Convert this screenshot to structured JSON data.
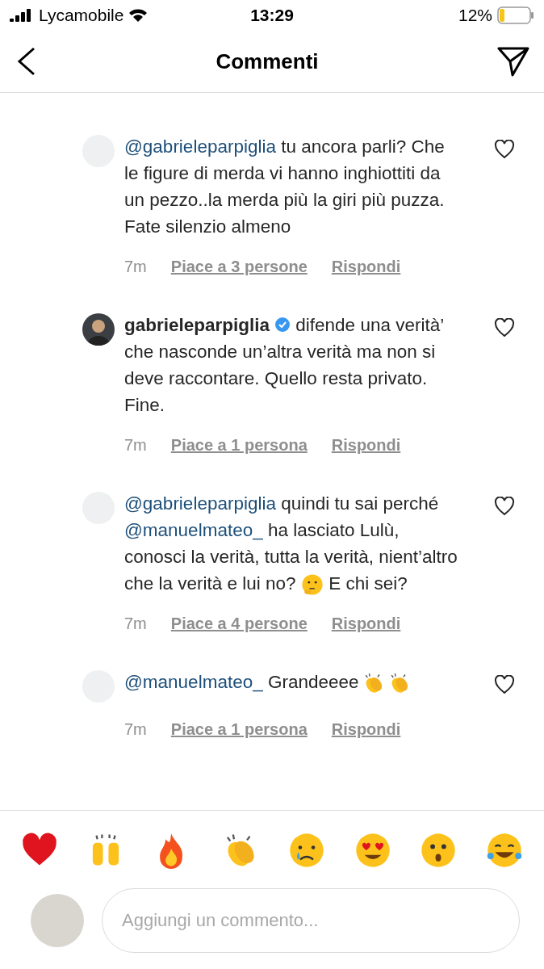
{
  "status_bar": {
    "carrier": "Lycamobile",
    "time": "13:29",
    "battery": "12%"
  },
  "header": {
    "title": "Commenti"
  },
  "comments": [
    {
      "avatar": {
        "kind": "blank"
      },
      "body": [
        {
          "kind": "mention",
          "text": "@gabrieleparpiglia"
        },
        {
          "kind": "text",
          "text": " tu ancora parli? Che le figure di merda vi hanno inghiottiti da un pezzo..la merda più la giri più puzza. Fate silenzio almeno"
        }
      ],
      "liked": false,
      "time": "7m",
      "likes": "Piace a 3 persone",
      "reply": "Rispondi"
    },
    {
      "avatar": {
        "kind": "photo"
      },
      "body": [
        {
          "kind": "username",
          "text": "gabrieleparpiglia"
        },
        {
          "kind": "verified"
        },
        {
          "kind": "text",
          "text": " difende una verità’ che nasconde un’altra verità ma non si deve raccontare. Quello resta privato. Fine."
        }
      ],
      "liked": false,
      "time": "7m",
      "likes": "Piace a 1 persona",
      "reply": "Rispondi"
    },
    {
      "avatar": {
        "kind": "blank"
      },
      "body": [
        {
          "kind": "mention",
          "text": "@gabrieleparpiglia"
        },
        {
          "kind": "text",
          "text": " quindi tu sai perché "
        },
        {
          "kind": "mention",
          "text": "@manuelmateo_"
        },
        {
          "kind": "text",
          "text": " ha lasciato Lulù, conosci la verità, tutta la verità, nient’altro che la verità e lui no? "
        },
        {
          "kind": "thinking"
        },
        {
          "kind": "text",
          "text": " E chi sei?"
        }
      ],
      "liked": false,
      "time": "7m",
      "likes": "Piace a 4 persone",
      "reply": "Rispondi"
    },
    {
      "avatar": {
        "kind": "blank"
      },
      "body": [
        {
          "kind": "mention",
          "text": "@manuelmateo_"
        },
        {
          "kind": "text",
          "text": " Grandeeee"
        },
        {
          "kind": "clap"
        },
        {
          "kind": "clap"
        }
      ],
      "liked": false,
      "time": "7m",
      "likes": "Piace a 1 persona",
      "reply": "Rispondi"
    }
  ],
  "reactions": [
    {
      "kind": "heart"
    },
    {
      "kind": "raised-hands"
    },
    {
      "kind": "fire"
    },
    {
      "kind": "clap"
    },
    {
      "kind": "crying"
    },
    {
      "kind": "heart-eyes"
    },
    {
      "kind": "surprised"
    },
    {
      "kind": "tears-of-joy"
    }
  ],
  "composer": {
    "placeholder": "Aggiungi un commento..."
  }
}
